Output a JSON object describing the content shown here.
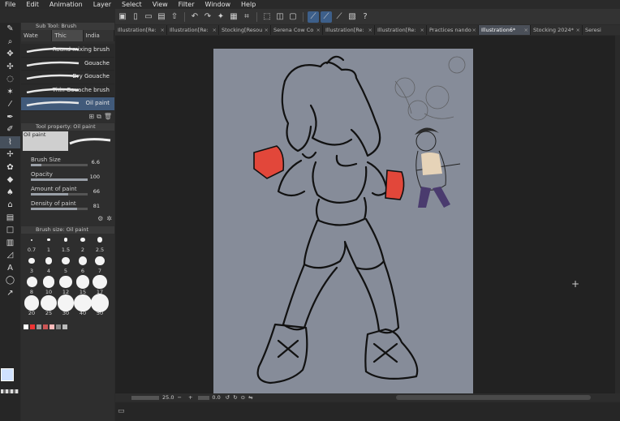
{
  "menu": [
    "File",
    "Edit",
    "Animation",
    "Layer",
    "Select",
    "View",
    "Filter",
    "Window",
    "Help"
  ],
  "doc_tabs": [
    "Illustration[Re:",
    "Illustration[Re:",
    "Stocking[Resou",
    "Serena Cow Co",
    "Illustration[Re:",
    "Illustration[Re:",
    "Practices nando",
    "Illustration6*",
    "Stocking 2024*",
    "Seresi"
  ],
  "active_tab_index": 7,
  "subtool": {
    "header": "Sub Tool: Brush",
    "tabs": [
      "Wate",
      "Thic",
      "India"
    ],
    "brushes": [
      "Round mixing brush",
      "Gouache",
      "Dry Gouache",
      "Thin Gouache brush",
      "Oil paint"
    ],
    "selected_brush_index": 4
  },
  "tool_property": {
    "header": "Tool property: Oil paint",
    "preview_label": "Oil paint",
    "props": [
      {
        "label": "Brush Size",
        "value": "6.6",
        "fill": 0.18
      },
      {
        "label": "Opacity",
        "value": "100",
        "fill": 1.0
      },
      {
        "label": "Amount of paint",
        "value": "66",
        "fill": 0.66
      },
      {
        "label": "Density of paint",
        "value": "81",
        "fill": 0.81
      }
    ]
  },
  "brush_size": {
    "header": "Brush size: Oil paint",
    "sizes": [
      "0.7",
      "1",
      "1.5",
      "2",
      "2.5",
      "3",
      "4",
      "5",
      "6",
      "7",
      "8",
      "10",
      "12",
      "15",
      "17",
      "20",
      "25",
      "30",
      "40",
      "50"
    ]
  },
  "status": {
    "zoom": "25.0",
    "angle": "0.0"
  },
  "colors": {
    "accent": "#3d5f8a",
    "paper": "#868c99",
    "fg_color": "#cfe1ff"
  }
}
